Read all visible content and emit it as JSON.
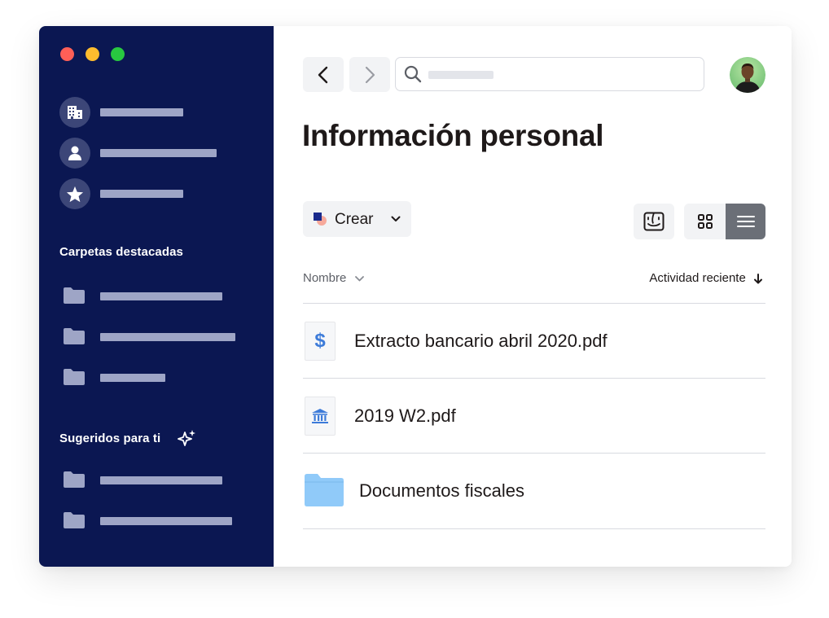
{
  "window_controls": [
    "close",
    "minimize",
    "zoom"
  ],
  "sidebar": {
    "nav_items": [
      {
        "icon": "building-icon"
      },
      {
        "icon": "person-icon"
      },
      {
        "icon": "star-icon"
      }
    ],
    "featured_label": "Carpetas destacadas",
    "featured_folders": [
      {
        "icon": "folder-icon"
      },
      {
        "icon": "folder-icon"
      },
      {
        "icon": "folder-icon"
      }
    ],
    "suggested_label": "Sugeridos para ti",
    "suggested_icon": "sparkle-icon",
    "suggested_folders": [
      {
        "icon": "folder-icon"
      },
      {
        "icon": "folder-icon"
      }
    ]
  },
  "toolbar": {
    "back_icon": "chevron-left-icon",
    "forward_icon": "chevron-right-icon",
    "search_icon": "search-icon"
  },
  "main": {
    "title": "Información personal",
    "create_label": "Crear",
    "columns": {
      "name": "Nombre",
      "activity": "Actividad reciente"
    },
    "files": [
      {
        "name": "Extracto bancario abril 2020.pdf",
        "icon": "dollar-icon"
      },
      {
        "name": "2019 W2.pdf",
        "icon": "bank-icon"
      },
      {
        "name": "Documentos fiscales",
        "icon": "folder-icon"
      }
    ]
  },
  "colors": {
    "sidebar_bg": "#0b1752",
    "accent_blue": "#3d7bd9",
    "folder_blue": "#90caf9",
    "text_dark": "#1e1919"
  }
}
